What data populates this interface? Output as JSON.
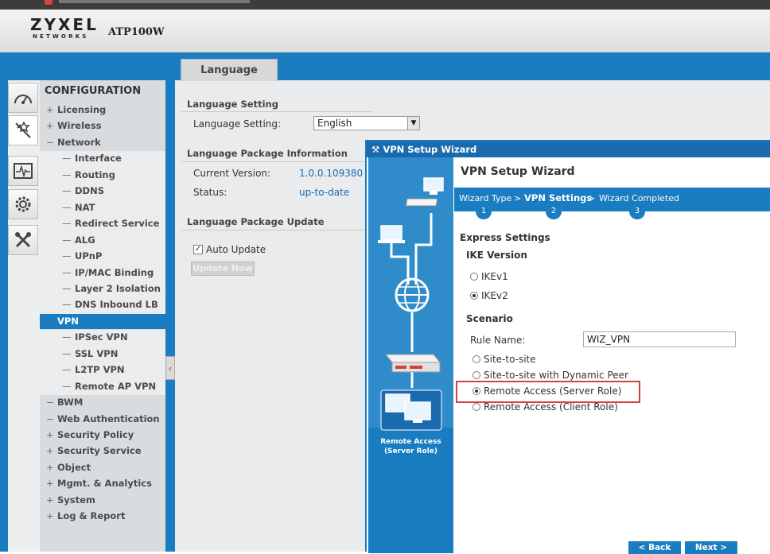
{
  "app": {
    "logo_top": "ZYXEL",
    "logo_bottom": "NETWORKS",
    "model": "ATP100W"
  },
  "main_tab": {
    "label": "Language"
  },
  "nav": {
    "title": "CONFIGURATION",
    "items": [
      {
        "label": "Licensing",
        "mark": "+",
        "level": 0
      },
      {
        "label": "Wireless",
        "mark": "+",
        "level": 0
      },
      {
        "label": "Network",
        "mark": "−",
        "level": 0
      },
      {
        "label": "Interface",
        "mark": "—",
        "level": 1
      },
      {
        "label": "Routing",
        "mark": "—",
        "level": 1
      },
      {
        "label": "DDNS",
        "mark": "—",
        "level": 1
      },
      {
        "label": "NAT",
        "mark": "—",
        "level": 1
      },
      {
        "label": "Redirect Service",
        "mark": "—",
        "level": 1
      },
      {
        "label": "ALG",
        "mark": "—",
        "level": 1
      },
      {
        "label": "UPnP",
        "mark": "—",
        "level": 1
      },
      {
        "label": "IP/MAC Binding",
        "mark": "—",
        "level": 1
      },
      {
        "label": "Layer 2 Isolation",
        "mark": "—",
        "level": 1
      },
      {
        "label": "DNS Inbound LB",
        "mark": "—",
        "level": 1
      },
      {
        "label": "VPN",
        "mark": "−",
        "level": 0,
        "selected": true
      },
      {
        "label": "IPSec VPN",
        "mark": "—",
        "level": 1
      },
      {
        "label": "SSL VPN",
        "mark": "—",
        "level": 1
      },
      {
        "label": "L2TP VPN",
        "mark": "—",
        "level": 1
      },
      {
        "label": "Remote AP VPN",
        "mark": "—",
        "level": 1
      },
      {
        "label": "BWM",
        "mark": "−",
        "level": 0
      },
      {
        "label": "Web Authentication",
        "mark": "−",
        "level": 0
      },
      {
        "label": "Security Policy",
        "mark": "+",
        "level": 0
      },
      {
        "label": "Security Service",
        "mark": "+",
        "level": 0
      },
      {
        "label": "Object",
        "mark": "+",
        "level": 0
      },
      {
        "label": "Mgmt. & Analytics",
        "mark": "+",
        "level": 0
      },
      {
        "label": "System",
        "mark": "+",
        "level": 0
      },
      {
        "label": "Log & Report",
        "mark": "+",
        "level": 0
      }
    ]
  },
  "language": {
    "setting_header": "Language Setting",
    "setting_label": "Language Setting:",
    "setting_value": "English",
    "package_header": "Language Package Information",
    "current_version_label": "Current Version:",
    "current_version_value": "1.0.0.109380",
    "status_label": "Status:",
    "status_value": "up-to-date",
    "update_header": "Language Package Update",
    "auto_update_label": "Auto Update",
    "update_now_label": "Update Now"
  },
  "wizard": {
    "window_title": "VPN Setup Wizard",
    "heading": "VPN Setup Wizard",
    "steps": [
      {
        "label": "Wizard Type",
        "num": "1"
      },
      {
        "label": "VPN Settings",
        "num": "2"
      },
      {
        "label": "Wizard Completed",
        "num": "3"
      }
    ],
    "step_sep": ">",
    "left_caption_1": "Remote Access",
    "left_caption_2": "(Server Role)",
    "express_header": "Express Settings",
    "ike_header": "IKE Version",
    "ike_options": [
      "IKEv1",
      "IKEv2"
    ],
    "scenario_header": "Scenario",
    "rule_name_label": "Rule Name:",
    "rule_name_value": "WIZ_VPN",
    "scenario_options": [
      "Site-to-site",
      "Site-to-site with Dynamic Peer",
      "Remote Access (Server Role)",
      "Remote Access (Client Role)"
    ],
    "back_label": "< Back",
    "next_label": "Next >"
  },
  "colors": {
    "accent": "#1a7cc1",
    "highlight": "#d24040"
  }
}
